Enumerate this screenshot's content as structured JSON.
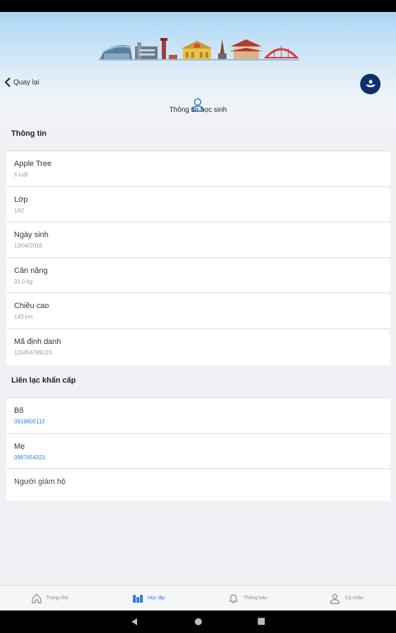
{
  "header": {
    "back_label": "Quay lại",
    "page_title": "Thông tin học sinh",
    "logo_icon": "school-crest-icon"
  },
  "info_section": {
    "title": "Thông tin",
    "rows": [
      {
        "label": "Apple Tree",
        "value": "6 tuổi"
      },
      {
        "label": "Lớp",
        "value": "1A2"
      },
      {
        "label": "Ngày sinh",
        "value": "13/04/2016"
      },
      {
        "label": "Cân nặng",
        "value": "31.0 kg"
      },
      {
        "label": "Chiều cao",
        "value": "143 cm"
      },
      {
        "label": "Mã định danh",
        "value": "123456789123"
      }
    ]
  },
  "contact_section": {
    "title": "Liên lạc khẩn cấp",
    "rows": [
      {
        "label": "Bố",
        "value": "0919805112"
      },
      {
        "label": "Mẹ",
        "value": "0987654321"
      },
      {
        "label": "Người giám hộ",
        "value": ""
      }
    ]
  },
  "bottom_nav": {
    "items": [
      {
        "label": "Trang chủ",
        "icon": "home-icon"
      },
      {
        "label": "Học tập",
        "icon": "study-icon",
        "active": true
      },
      {
        "label": "Thông báo",
        "icon": "bell-icon"
      },
      {
        "label": "Cá nhân",
        "icon": "person-icon"
      }
    ]
  },
  "colors": {
    "accent": "#2f7be0",
    "logo_bg": "#0d2f6b",
    "background": "#f0f1f5"
  }
}
